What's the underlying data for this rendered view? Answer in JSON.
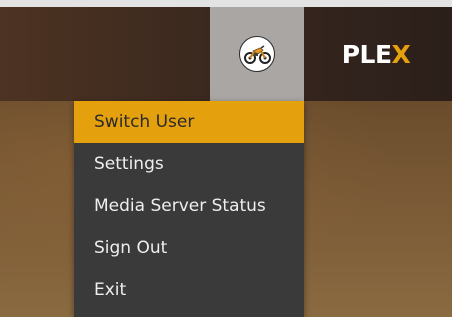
{
  "header": {
    "logo": {
      "prefix": "PLE",
      "accent_letter": "X"
    },
    "avatar": {
      "icon": "motorcycle-avatar-icon"
    }
  },
  "menu": {
    "items": [
      {
        "label": "Switch User",
        "active": true
      },
      {
        "label": "Settings",
        "active": false
      },
      {
        "label": "Media Server Status",
        "active": false
      },
      {
        "label": "Sign Out",
        "active": false
      },
      {
        "label": "Exit",
        "active": false
      }
    ]
  },
  "colors": {
    "accent": "#e5a00d",
    "menu_bg": "#3a3a3a",
    "avatar_tile_bg": "#a9a6a3"
  }
}
